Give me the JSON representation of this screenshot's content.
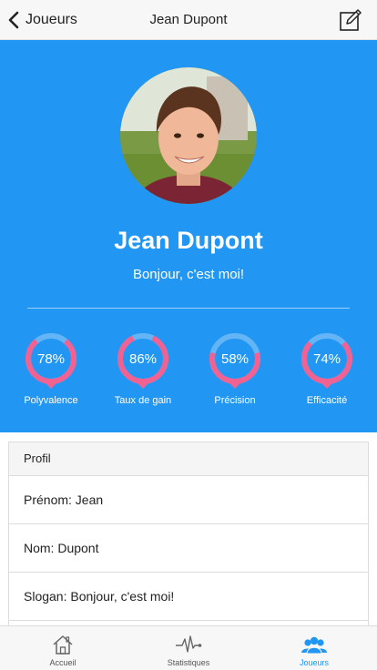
{
  "navbar": {
    "back_label": "Joueurs",
    "title": "Jean Dupont",
    "back_icon": "chevron-left-icon",
    "edit_icon": "edit-icon"
  },
  "player": {
    "name": "Jean Dupont",
    "slogan": "Bonjour, c'est moi!"
  },
  "stats": [
    {
      "label": "Polyvalence",
      "value": 78,
      "display": "78%"
    },
    {
      "label": "Taux de gain",
      "value": 86,
      "display": "86%"
    },
    {
      "label": "Précision",
      "value": 58,
      "display": "58%"
    },
    {
      "label": "Efficacité",
      "value": 74,
      "display": "74%"
    }
  ],
  "profile": {
    "header": "Profil",
    "rows": [
      "Prénom: Jean",
      "Nom: Dupont",
      "Slogan: Bonjour, c'est moi!"
    ]
  },
  "tabbar": {
    "tabs": [
      {
        "label": "Accueil",
        "icon": "home-icon",
        "active": false
      },
      {
        "label": "Statistiques",
        "icon": "pulse-icon",
        "active": false
      },
      {
        "label": "Joueurs",
        "icon": "users-icon",
        "active": true
      }
    ]
  },
  "colors": {
    "primary": "#2196f3",
    "gauge_track": "#64b5f6",
    "gauge_fill": "#f06292"
  }
}
